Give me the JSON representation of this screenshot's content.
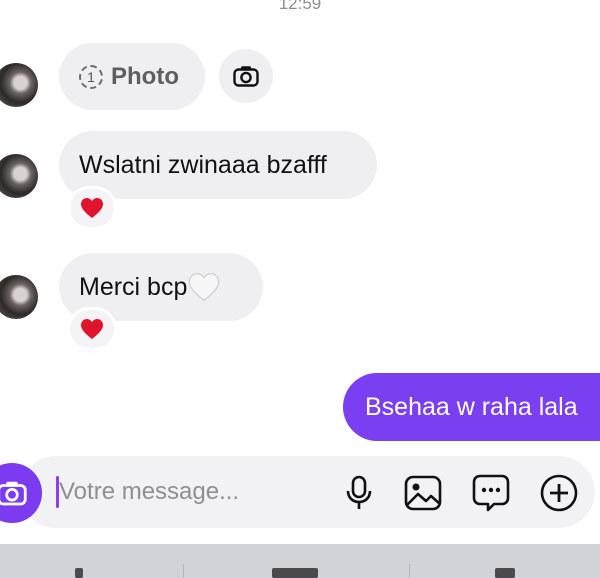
{
  "status": {
    "time": "12:59"
  },
  "messages": {
    "photo": {
      "count": "1",
      "label": "Photo"
    },
    "received": [
      {
        "text": "Wslatni zwinaaa bzafff",
        "reaction": "heart-red"
      },
      {
        "text": "Merci bcp",
        "trailing_emoji": "white-heart",
        "reaction": "heart-red"
      }
    ],
    "sent": [
      {
        "text": "Bsehaa w raha lala"
      }
    ]
  },
  "composer": {
    "placeholder": "Votre message...",
    "icons": [
      "camera-icon",
      "microphone-icon",
      "gallery-icon",
      "sticker-chat-icon",
      "plus-icon"
    ]
  },
  "colors": {
    "accent": "#7b3ff2",
    "bubble_received": "#efeff1",
    "bubble_sent_text": "#ffffff",
    "composer_bg": "#f2f2f5",
    "reaction_heart": "#e0142c"
  }
}
